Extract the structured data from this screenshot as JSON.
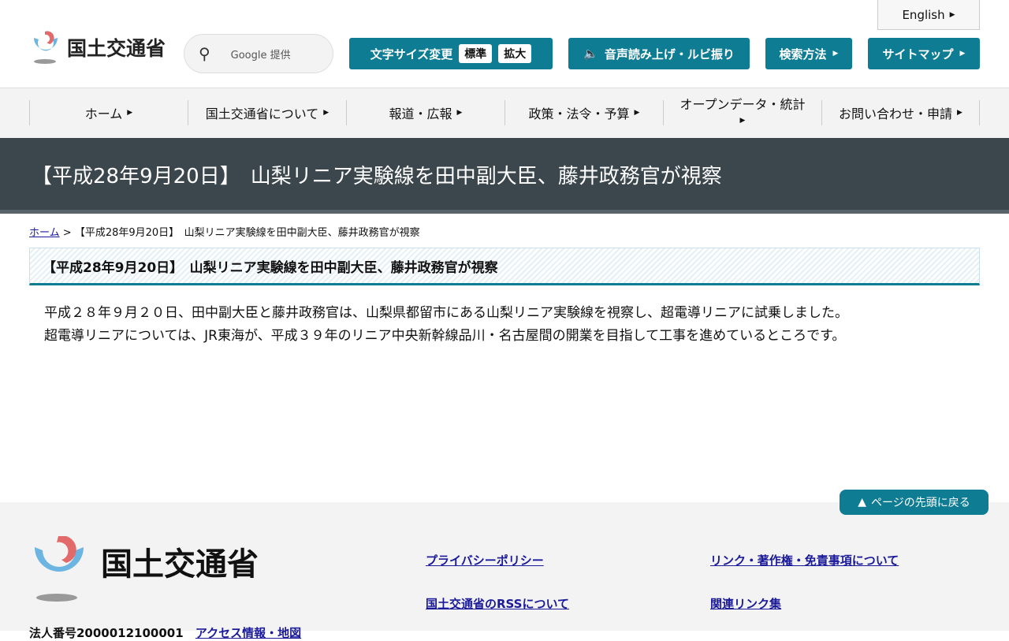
{
  "header": {
    "logo_text": "国土交通省",
    "search_placeholder": "Google 提供",
    "english": "English",
    "font_size": {
      "label": "文字サイズ変更",
      "standard": "標準",
      "large": "拡大"
    },
    "read_aloud": "音声読み上げ・ルビ振り",
    "search_method": "検索方法",
    "sitemap": "サイトマップ"
  },
  "nav": [
    {
      "label": "ホーム"
    },
    {
      "label": "国土交通省について"
    },
    {
      "label": "報道・広報"
    },
    {
      "label": "政策・法令・予算"
    },
    {
      "label": "オープンデータ・統計"
    },
    {
      "label": "お問い合わせ・申請"
    }
  ],
  "banner": {
    "title": "【平成28年9月20日】　山梨リニア実験線を田中副大臣、藤井政務官が視察"
  },
  "breadcrumb": {
    "home": "ホーム",
    "sep": ">",
    "current": "【平成28年9月20日】　山梨リニア実験線を田中副大臣、藤井政務官が視察"
  },
  "article": {
    "heading": "【平成28年9月20日】　山梨リニア実験線を田中副大臣、藤井政務官が視察",
    "paragraphs": [
      "平成２８年９月２０日、田中副大臣と藤井政務官は、山梨県都留市にある山梨リニア実験線を視察し、超電導リニアに試乗しました。",
      "超電導リニアについては、JR東海が、平成３９年のリニア中央新幹線品川・名古屋間の開業を目指して工事を進めているところです。"
    ]
  },
  "page_top": "ページの先頭に戻る",
  "footer": {
    "logo_text": "国土交通省",
    "links": [
      "プライバシーポリシー",
      "リンク・著作権・免責事項について",
      "国土交通省のRSSについて",
      "関連リンク集"
    ],
    "corp_no": "法人番号2000012100001",
    "access": "アクセス情報・地図"
  },
  "colors": {
    "accent": "#0e7c93",
    "banner": "#3c474d",
    "link": "#1a1a9a"
  }
}
